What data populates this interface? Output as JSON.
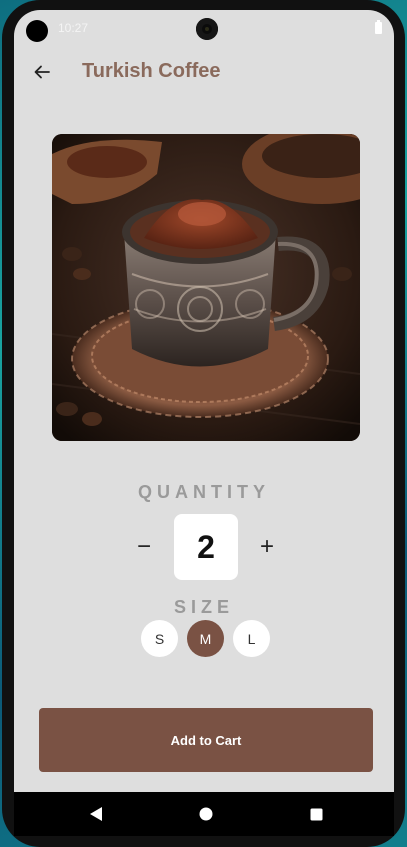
{
  "status_bar": {
    "time": "10:27"
  },
  "app_bar": {
    "title": "Turkish Coffee",
    "back_icon": "arrow-left-icon"
  },
  "product_image": {
    "subject": "turkish-coffee-cup-icon"
  },
  "quantity": {
    "label": "QUANTITY",
    "value": "2",
    "decrement": "−",
    "increment": "+"
  },
  "size": {
    "label": "SIZE",
    "options": [
      "S",
      "M",
      "L"
    ],
    "selected": "M"
  },
  "cart_button": {
    "label": "Add to Cart"
  },
  "colors": {
    "accent": "#7a5244",
    "title": "#8a6a5c",
    "background": "#dedede",
    "label_gray": "#9a9a9a"
  },
  "nav": {
    "back": "triangle-back-icon",
    "home": "circle-home-icon",
    "recents": "square-recents-icon"
  }
}
